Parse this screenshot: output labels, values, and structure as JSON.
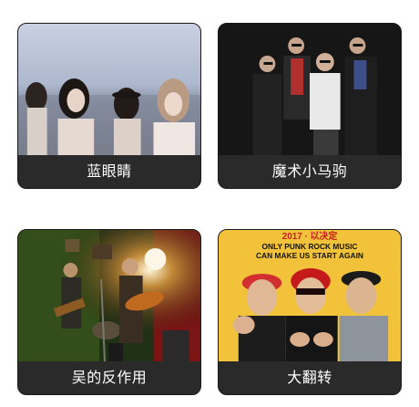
{
  "bands": [
    {
      "name": "蓝眼睛"
    },
    {
      "name": "魔术小马驹"
    },
    {
      "name": "吴的反作用"
    },
    {
      "name": "大翻转"
    }
  ],
  "posters": {
    "band4_headline": "2017 · 以决定",
    "band4_line1": "ONLY PUNK ROCK MUSIC",
    "band4_line2": "CAN MAKE US START AGAIN"
  },
  "colors": {
    "caption_bg": "#2a2a2a",
    "caption_text": "#ffffff",
    "card_border": "#1a1a1a"
  }
}
